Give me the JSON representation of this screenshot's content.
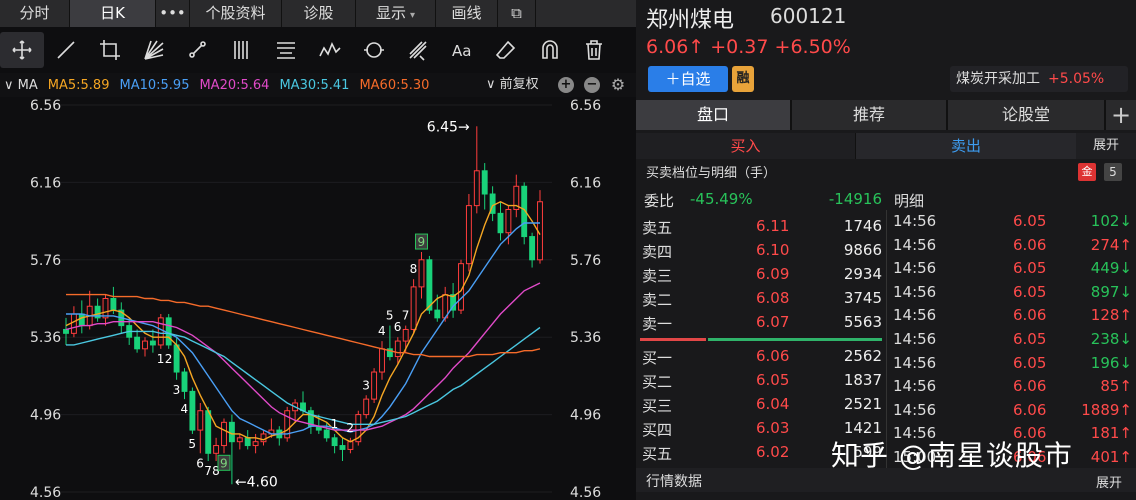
{
  "tabs": [
    {
      "label": "分时",
      "width": 70
    },
    {
      "label": "日K",
      "width": 86,
      "active": true
    },
    {
      "label": "•••",
      "width": 34
    },
    {
      "label": "个股资料",
      "width": 92
    },
    {
      "label": "诊股",
      "width": 74
    },
    {
      "label": "显示",
      "width": 80,
      "caret": "▾"
    },
    {
      "label": "画线",
      "width": 62
    },
    {
      "label": "⧉",
      "width": 38
    }
  ],
  "toolbar": [
    "crosshair-icon",
    "line-icon",
    "crop-icon",
    "fan-icon",
    "segment-icon",
    "parallel-icon",
    "text-lines-icon",
    "wave-icon",
    "cycle-icon",
    "pitchfork-icon",
    "text-icon",
    "eraser-icon",
    "magnet-icon",
    "trash-icon"
  ],
  "ma_bar": {
    "prefix": "∨ MA",
    "items": [
      {
        "label": "MA5:5.89",
        "color": "#f5a623"
      },
      {
        "label": "MA10:5.95",
        "color": "#4a9ff5"
      },
      {
        "label": "MA20:5.64",
        "color": "#e04ac8"
      },
      {
        "label": "MA30:5.41",
        "color": "#4ac7e0"
      },
      {
        "label": "MA60:5.30",
        "color": "#f56b2a"
      }
    ],
    "fuquan": "∨ 前复权",
    "plus": "+",
    "minus": "−",
    "gear": "⚙"
  },
  "chart_data": {
    "type": "candlestick",
    "ylim": [
      4.56,
      6.56
    ],
    "yticks": [
      "6.56",
      "6.16",
      "5.76",
      "5.36",
      "4.96",
      "4.56"
    ],
    "annotations": [
      {
        "text": "6.45→",
        "value": 6.45
      },
      {
        "text": "←4.60",
        "value": 4.6
      }
    ],
    "td_labels": [
      "1",
      "2",
      "3",
      "4",
      "5",
      "6",
      "7",
      "8",
      "9",
      "1",
      "2",
      "3",
      "4",
      "5",
      "6",
      "7",
      "8",
      "9"
    ],
    "candles": [
      [
        5.4,
        5.46,
        5.32,
        5.38
      ],
      [
        5.38,
        5.52,
        5.36,
        5.48
      ],
      [
        5.48,
        5.55,
        5.38,
        5.42
      ],
      [
        5.42,
        5.6,
        5.4,
        5.52
      ],
      [
        5.52,
        5.56,
        5.44,
        5.46
      ],
      [
        5.46,
        5.58,
        5.42,
        5.56
      ],
      [
        5.56,
        5.62,
        5.48,
        5.5
      ],
      [
        5.5,
        5.54,
        5.38,
        5.42
      ],
      [
        5.42,
        5.46,
        5.32,
        5.36
      ],
      [
        5.36,
        5.4,
        5.28,
        5.3
      ],
      [
        5.3,
        5.36,
        5.26,
        5.34
      ],
      [
        5.34,
        5.4,
        5.28,
        5.32
      ],
      [
        5.32,
        5.48,
        5.3,
        5.46
      ],
      [
        5.46,
        5.48,
        5.3,
        5.32
      ],
      [
        5.32,
        5.36,
        5.14,
        5.18
      ],
      [
        5.18,
        5.2,
        5.04,
        5.08
      ],
      [
        5.08,
        5.1,
        4.86,
        4.88
      ],
      [
        4.88,
        5.02,
        4.76,
        4.98
      ],
      [
        4.98,
        5.0,
        4.72,
        4.76
      ],
      [
        4.76,
        4.84,
        4.72,
        4.8
      ],
      [
        4.8,
        4.94,
        4.76,
        4.92
      ],
      [
        4.92,
        4.96,
        4.6,
        4.82
      ],
      [
        4.82,
        4.86,
        4.78,
        4.84
      ],
      [
        4.84,
        4.88,
        4.78,
        4.8
      ],
      [
        4.8,
        4.86,
        4.76,
        4.82
      ],
      [
        4.82,
        4.88,
        4.8,
        4.86
      ],
      [
        4.86,
        4.94,
        4.84,
        4.88
      ],
      [
        4.88,
        4.9,
        4.8,
        4.84
      ],
      [
        4.84,
        5.0,
        4.82,
        4.98
      ],
      [
        4.98,
        5.04,
        4.92,
        5.02
      ],
      [
        5.02,
        5.08,
        4.96,
        4.98
      ],
      [
        4.98,
        5.0,
        4.86,
        4.9
      ],
      [
        4.9,
        4.96,
        4.86,
        4.88
      ],
      [
        4.88,
        4.92,
        4.82,
        4.84
      ],
      [
        4.84,
        4.86,
        4.76,
        4.8
      ],
      [
        4.8,
        4.84,
        4.72,
        4.78
      ],
      [
        4.78,
        4.84,
        4.76,
        4.82
      ],
      [
        4.82,
        4.98,
        4.8,
        4.96
      ],
      [
        4.96,
        5.06,
        4.94,
        5.04
      ],
      [
        5.04,
        5.2,
        5.02,
        5.18
      ],
      [
        5.18,
        5.34,
        5.14,
        5.3
      ],
      [
        5.3,
        5.42,
        5.24,
        5.26
      ],
      [
        5.26,
        5.36,
        5.22,
        5.34
      ],
      [
        5.34,
        5.42,
        5.28,
        5.4
      ],
      [
        5.4,
        5.66,
        5.38,
        5.62
      ],
      [
        5.62,
        5.8,
        5.56,
        5.76
      ],
      [
        5.76,
        5.78,
        5.48,
        5.5
      ],
      [
        5.5,
        5.58,
        5.44,
        5.46
      ],
      [
        5.46,
        5.62,
        5.44,
        5.58
      ],
      [
        5.58,
        5.64,
        5.46,
        5.5
      ],
      [
        5.5,
        5.76,
        5.48,
        5.74
      ],
      [
        5.74,
        6.1,
        5.7,
        6.04
      ],
      [
        6.04,
        6.45,
        6.0,
        6.22
      ],
      [
        6.22,
        6.26,
        6.02,
        6.1
      ],
      [
        6.1,
        6.14,
        5.96,
        6.0
      ],
      [
        6.0,
        6.06,
        5.86,
        5.9
      ],
      [
        5.9,
        6.04,
        5.84,
        6.02
      ],
      [
        6.02,
        6.2,
        5.98,
        6.14
      ],
      [
        6.14,
        6.16,
        5.84,
        5.88
      ],
      [
        5.88,
        5.9,
        5.72,
        5.76
      ],
      [
        5.76,
        6.12,
        5.74,
        6.06
      ]
    ],
    "ma": {
      "MA5": [
        5.42,
        5.44,
        5.46,
        5.47,
        5.48,
        5.49,
        5.5,
        5.49,
        5.46,
        5.42,
        5.38,
        5.36,
        5.36,
        5.36,
        5.32,
        5.26,
        5.15,
        5.06,
        4.98,
        4.9,
        4.88,
        4.86,
        4.86,
        4.84,
        4.84,
        4.83,
        4.85,
        4.86,
        4.88,
        4.92,
        4.96,
        4.96,
        4.94,
        4.92,
        4.88,
        4.84,
        4.82,
        4.84,
        4.88,
        4.95,
        5.06,
        5.15,
        5.22,
        5.3,
        5.38,
        5.48,
        5.52,
        5.56,
        5.58,
        5.57,
        5.6,
        5.68,
        5.82,
        5.94,
        6.04,
        6.06,
        6.04,
        6.04,
        6.02,
        5.96,
        5.89
      ],
      "MA10": [
        5.48,
        5.48,
        5.48,
        5.47,
        5.47,
        5.47,
        5.47,
        5.46,
        5.45,
        5.44,
        5.43,
        5.42,
        5.4,
        5.38,
        5.36,
        5.32,
        5.28,
        5.22,
        5.16,
        5.1,
        5.04,
        4.98,
        4.94,
        4.92,
        4.9,
        4.88,
        4.86,
        4.86,
        4.86,
        4.87,
        4.88,
        4.9,
        4.9,
        4.9,
        4.89,
        4.88,
        4.87,
        4.88,
        4.89,
        4.91,
        4.95,
        5.0,
        5.06,
        5.12,
        5.2,
        5.28,
        5.34,
        5.4,
        5.46,
        5.52,
        5.56,
        5.6,
        5.66,
        5.72,
        5.78,
        5.84,
        5.88,
        5.92,
        5.95,
        5.95,
        5.95
      ],
      "MA20": [
        5.4,
        5.41,
        5.42,
        5.42,
        5.43,
        5.43,
        5.44,
        5.44,
        5.44,
        5.44,
        5.44,
        5.44,
        5.43,
        5.42,
        5.41,
        5.39,
        5.37,
        5.34,
        5.31,
        5.28,
        5.24,
        5.2,
        5.16,
        5.12,
        5.08,
        5.04,
        5.0,
        4.97,
        4.95,
        4.93,
        4.92,
        4.91,
        4.9,
        4.89,
        4.88,
        4.88,
        4.88,
        4.88,
        4.88,
        4.89,
        4.9,
        4.92,
        4.94,
        4.96,
        4.99,
        5.03,
        5.07,
        5.11,
        5.15,
        5.2,
        5.24,
        5.28,
        5.33,
        5.38,
        5.43,
        5.48,
        5.52,
        5.56,
        5.6,
        5.62,
        5.64
      ],
      "MA30": [
        5.32,
        5.32,
        5.33,
        5.34,
        5.35,
        5.36,
        5.37,
        5.38,
        5.39,
        5.39,
        5.39,
        5.39,
        5.38,
        5.38,
        5.37,
        5.36,
        5.34,
        5.32,
        5.3,
        5.28,
        5.26,
        5.23,
        5.2,
        5.17,
        5.14,
        5.11,
        5.08,
        5.05,
        5.02,
        5.0,
        4.98,
        4.96,
        4.95,
        4.94,
        4.93,
        4.92,
        4.91,
        4.91,
        4.91,
        4.91,
        4.92,
        4.93,
        4.94,
        4.95,
        4.97,
        4.99,
        5.01,
        5.03,
        5.06,
        5.09,
        5.11,
        5.14,
        5.17,
        5.2,
        5.23,
        5.26,
        5.29,
        5.32,
        5.35,
        5.38,
        5.41
      ],
      "MA60": [
        5.58,
        5.58,
        5.58,
        5.58,
        5.58,
        5.58,
        5.57,
        5.57,
        5.57,
        5.57,
        5.56,
        5.56,
        5.55,
        5.55,
        5.54,
        5.54,
        5.53,
        5.52,
        5.52,
        5.51,
        5.5,
        5.49,
        5.48,
        5.47,
        5.46,
        5.45,
        5.44,
        5.43,
        5.42,
        5.41,
        5.4,
        5.39,
        5.38,
        5.37,
        5.36,
        5.35,
        5.34,
        5.33,
        5.32,
        5.31,
        5.3,
        5.29,
        5.28,
        5.28,
        5.27,
        5.27,
        5.26,
        5.26,
        5.26,
        5.26,
        5.26,
        5.26,
        5.27,
        5.27,
        5.27,
        5.28,
        5.28,
        5.28,
        5.29,
        5.29,
        5.3
      ]
    }
  },
  "stock": {
    "name": "郑州煤电",
    "code": "600121",
    "quote": "6.06↑ +0.37 +6.50%",
    "add_label": "＋自选",
    "rong": "融",
    "sector_name": "煤炭开采加工",
    "sector_chg": "+5.05%"
  },
  "subtabs": [
    {
      "label": "盘口",
      "width": 156,
      "active": true
    },
    {
      "label": "推荐",
      "width": 156
    },
    {
      "label": "论股堂",
      "width": 158
    }
  ],
  "plus_tab": "+",
  "buy_label": "买入",
  "sell_label": "卖出",
  "expand_label": "展开",
  "level_title": "买卖档位与明细（手）",
  "gold_icon": "金",
  "level_num": "5",
  "weibi": {
    "label": "委比",
    "ratio": "-45.49%",
    "diff": "-14916"
  },
  "mingxi_title": "明细",
  "asks": [
    {
      "label": "卖五",
      "price": "6.11",
      "vol": "1746"
    },
    {
      "label": "卖四",
      "price": "6.10",
      "vol": "9866"
    },
    {
      "label": "卖三",
      "price": "6.09",
      "vol": "2934"
    },
    {
      "label": "卖二",
      "price": "6.08",
      "vol": "3745"
    },
    {
      "label": "卖一",
      "price": "6.07",
      "vol": "5563"
    }
  ],
  "bids": [
    {
      "label": "买一",
      "price": "6.06",
      "vol": "2562"
    },
    {
      "label": "买二",
      "price": "6.05",
      "vol": "1837"
    },
    {
      "label": "买三",
      "price": "6.04",
      "vol": "2521"
    },
    {
      "label": "买四",
      "price": "6.03",
      "vol": "1421"
    },
    {
      "label": "买五",
      "price": "6.02",
      "vol": "599"
    }
  ],
  "ticks": [
    {
      "time": "14:56",
      "price": "6.05",
      "vol": "102↓",
      "dir": "dn"
    },
    {
      "time": "14:56",
      "price": "6.06",
      "vol": "274↑",
      "dir": "up"
    },
    {
      "time": "14:56",
      "price": "6.05",
      "vol": "449↓",
      "dir": "dn"
    },
    {
      "time": "14:56",
      "price": "6.05",
      "vol": "897↓",
      "dir": "dn"
    },
    {
      "time": "14:56",
      "price": "6.06",
      "vol": "128↑",
      "dir": "up"
    },
    {
      "time": "14:56",
      "price": "6.05",
      "vol": "238↓",
      "dir": "dn"
    },
    {
      "time": "14:56",
      "price": "6.05",
      "vol": "196↓",
      "dir": "dn"
    },
    {
      "time": "14:56",
      "price": "6.06",
      "vol": "85↑",
      "dir": "up"
    },
    {
      "time": "14:56",
      "price": "6.06",
      "vol": "1889↑",
      "dir": "up"
    },
    {
      "time": "14:56",
      "price": "6.06",
      "vol": "181↑",
      "dir": "up"
    },
    {
      "time": "15:00",
      "price": "6.06",
      "vol": "401↑",
      "dir": "up"
    }
  ],
  "hangqing_title": "行情数据",
  "watermark": "知乎 @南星谈股市"
}
